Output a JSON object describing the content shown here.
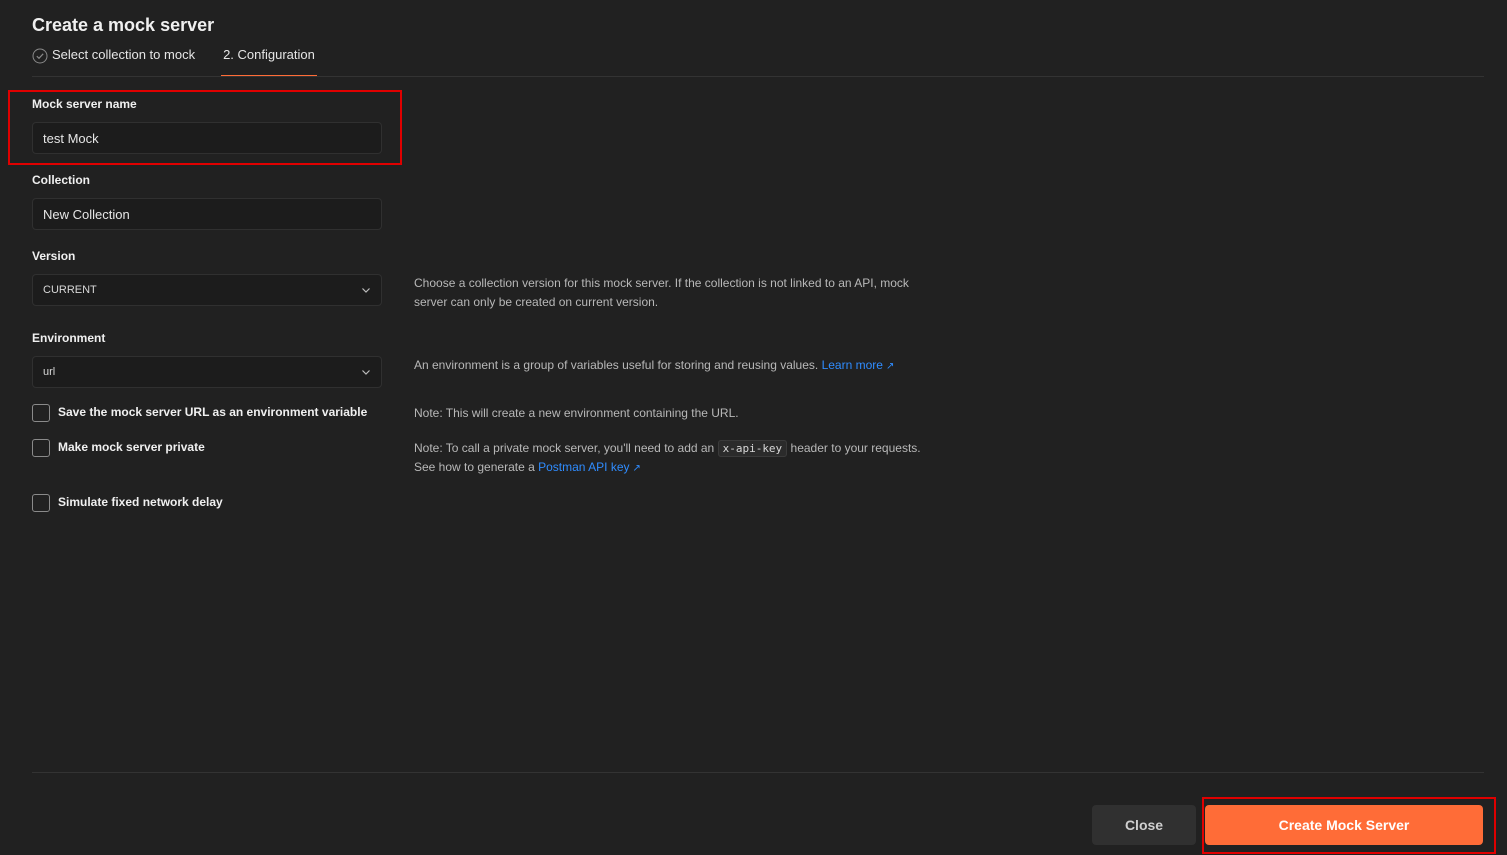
{
  "title": "Create a mock server",
  "steps": [
    {
      "label": "Select collection to mock",
      "status": "done"
    },
    {
      "label": "2. Configuration",
      "status": "active"
    }
  ],
  "form": {
    "name": {
      "label": "Mock server name",
      "value": "test Mock"
    },
    "collection": {
      "label": "Collection",
      "value": "New Collection"
    },
    "version": {
      "label": "Version",
      "value": "CURRENT",
      "help": "Choose a collection version for this mock server. If the collection is not linked to an API, mock server can only be created on current version."
    },
    "environment": {
      "label": "Environment",
      "value": "url",
      "help": "An environment is a group of variables useful for storing and reusing values.",
      "help_link": "Learn more"
    },
    "save_url": {
      "label": "Save the mock server URL as an environment variable",
      "checked": false,
      "note": "Note: This will create a new environment containing the URL."
    },
    "private": {
      "label": "Make mock server private",
      "checked": false,
      "note_before": "Note: To call a private mock server, you'll need to add an",
      "note_code": "x-api-key",
      "note_after": "header to your requests. See how to generate a",
      "note_link": "Postman API key"
    },
    "delay": {
      "label": "Simulate fixed network delay",
      "checked": false
    }
  },
  "buttons": {
    "close": "Close",
    "create": "Create Mock Server"
  },
  "icons": {
    "step_done": "check-circle-icon",
    "select_chevron": "chevron-down-icon",
    "external_link": "external-link-arrow-icon"
  },
  "colors": {
    "background": "#212121",
    "accent": "#ff6c37",
    "link": "#2f8cff",
    "highlight": "#e00000"
  }
}
